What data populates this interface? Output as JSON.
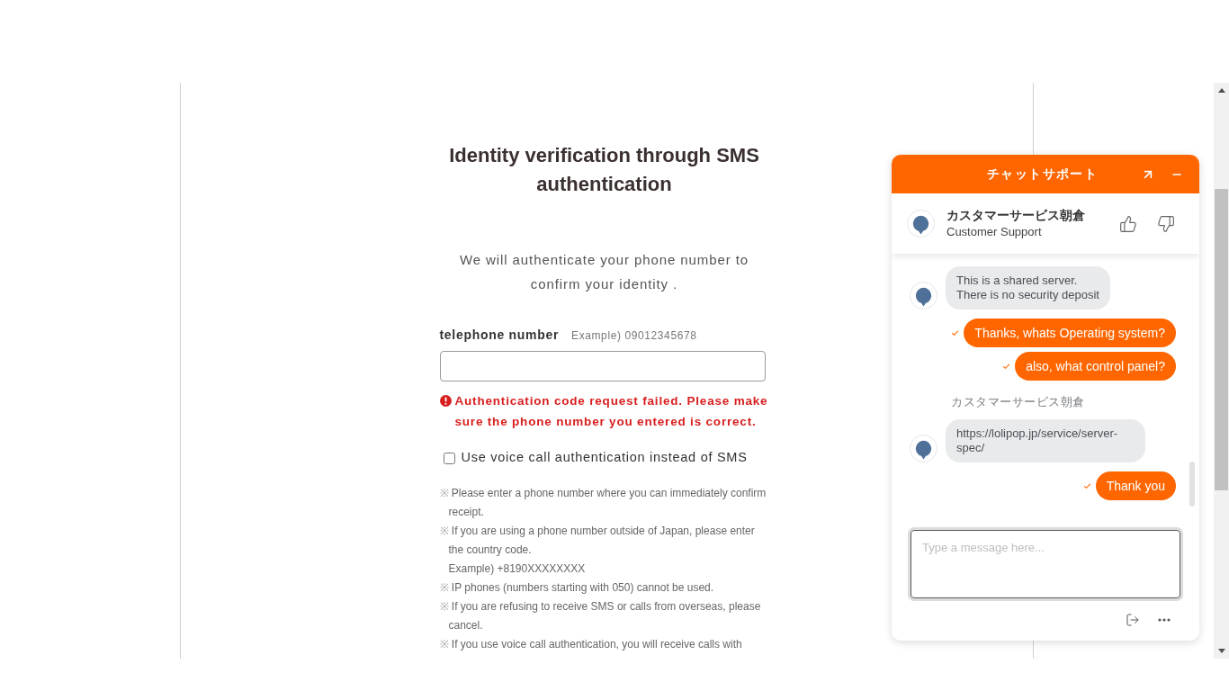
{
  "form": {
    "title": "Identity verification through SMS authentication",
    "description": "We will authenticate your phone number to confirm your identity .",
    "phone": {
      "label": "telephone number",
      "example": "Example) 09012345678"
    },
    "error": "Authentication code request failed. Please make sure the phone number you entered is correct.",
    "voice_call": {
      "label": "Use voice call authentication instead of SMS",
      "checked": false
    },
    "notes": [
      {
        "mark": "※",
        "text": "Please enter a phone number where you can immediately confirm receipt."
      },
      {
        "mark": "※",
        "text": "If you are using a phone number outside of Japan, please enter the country code.",
        "example": "Example) +8190XXXXXXXX"
      },
      {
        "mark": "※",
        "text": "IP phones (numbers starting with 050) cannot be used."
      },
      {
        "mark": "※",
        "text": "If you are refusing to receive SMS or calls from overseas, please cancel."
      },
      {
        "mark": "※",
        "text": "If you use voice call authentication, you will receive calls with"
      }
    ]
  },
  "chat": {
    "title": "チャットサポート",
    "agent": {
      "name": "カスタマーサービス朝倉",
      "role": "Customer Support"
    },
    "messages": [
      {
        "kind": "agent",
        "text": "This is a shared server.\nThere is no security deposit"
      },
      {
        "kind": "user",
        "text": "Thanks, whats Operating system?",
        "delivered": true
      },
      {
        "kind": "user",
        "text": "also, what control panel?",
        "delivered": true
      },
      {
        "kind": "agent",
        "sender": "カスタマーサービス朝倉",
        "text": "https://lolipop.jp/service/server-spec/"
      },
      {
        "kind": "user",
        "text": "Thank you",
        "delivered": true
      }
    ],
    "input": {
      "placeholder": "Type a message here..."
    }
  }
}
